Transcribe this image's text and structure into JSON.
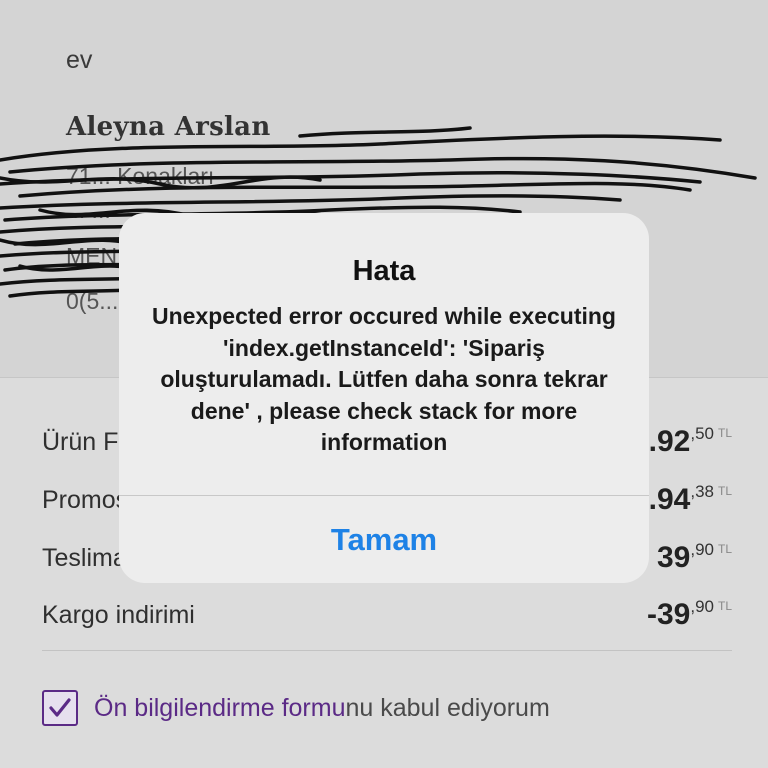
{
  "address": {
    "type": "ev",
    "name": "Aleyna Arslan",
    "lines": [
      "71... Konakları",
      "... ...",
      "MEN...",
      "0(5..."
    ]
  },
  "summary": [
    {
      "label": "Ürün Fiyatı",
      "big": "...92",
      "dec": ",50",
      "cur": "TL"
    },
    {
      "label": "Promosyon",
      "big": "-...94",
      "dec": ",38",
      "cur": "TL"
    },
    {
      "label": "Teslimat",
      "big": "39",
      "dec": ",90",
      "cur": "TL"
    },
    {
      "label": "Kargo indirimi",
      "big": "-39",
      "dec": ",90",
      "cur": "TL"
    }
  ],
  "consent": {
    "link_text": "Ön bilgilendirme formu",
    "rest_text": "nu kabul ediyorum",
    "checked": true
  },
  "alert": {
    "title": "Hata",
    "message": "Unexpected error occured while executing 'index.getInstanceId': 'Sipariş oluşturulamadı. Lütfen daha sonra tekrar dene' , please check stack for more information",
    "button": "Tamam"
  },
  "colors": {
    "accent_purple": "#5b2a86",
    "ios_blue": "#1e82e6"
  }
}
